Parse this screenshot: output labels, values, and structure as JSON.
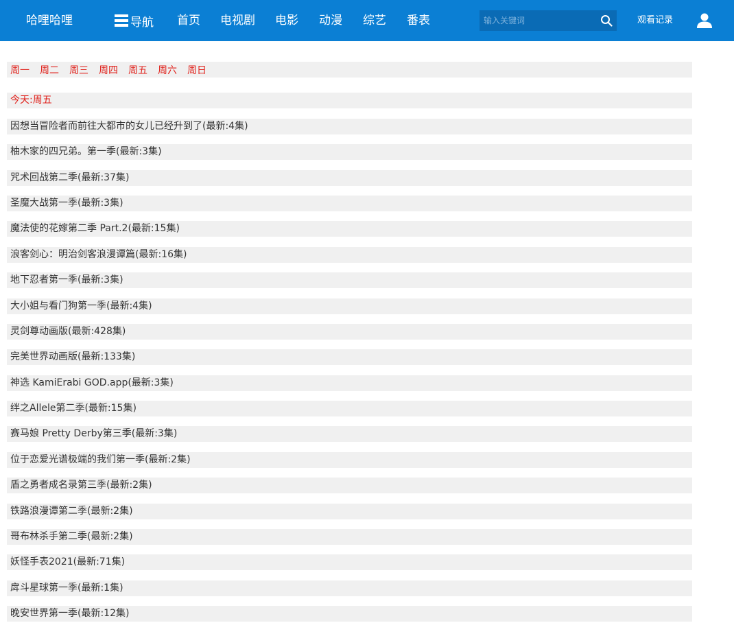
{
  "header": {
    "logo": "哈哩哈哩",
    "nav_label": "导航",
    "links": [
      "首页",
      "电视剧",
      "电影",
      "动漫",
      "综艺",
      "番表"
    ],
    "search_placeholder": "输入关键词",
    "history_label": "观看记录",
    "accent_color": "#0b7fd4"
  },
  "weekdays": [
    "周一",
    "周二",
    "周三",
    "周四",
    "周五",
    "周六",
    "周日"
  ],
  "today_label": "今天:周五",
  "shows": [
    "因想当冒险者而前往大都市的女儿已经升到了(最新:4集)",
    "柚木家的四兄弟。第一季(最新:3集)",
    "咒术回战第二季(最新:37集)",
    "圣魔大战第一季(最新:3集)",
    "魔法使的花嫁第二季 Part.2(最新:15集)",
    "浪客剑心：明治剑客浪漫谭篇(最新:16集)",
    "地下忍者第一季(最新:3集)",
    "大小姐与看门狗第一季(最新:4集)",
    "灵剑尊动画版(最新:428集)",
    "完美世界动画版(最新:133集)",
    "神选 KamiErabi GOD.app(最新:3集)",
    "绊之Allele第二季(最新:15集)",
    "赛马娘 Pretty Derby第三季(最新:3集)",
    "位于恋爱光谱极端的我们第一季(最新:2集)",
    "盾之勇者成名录第三季(最新:2集)",
    "铁路浪漫谭第二季(最新:2集)",
    "哥布林杀手第二季(最新:2集)",
    "妖怪手表2021(最新:71集)",
    "戽斗星球第一季(最新:1集)",
    "晚安世界第一季(最新:12集)"
  ]
}
